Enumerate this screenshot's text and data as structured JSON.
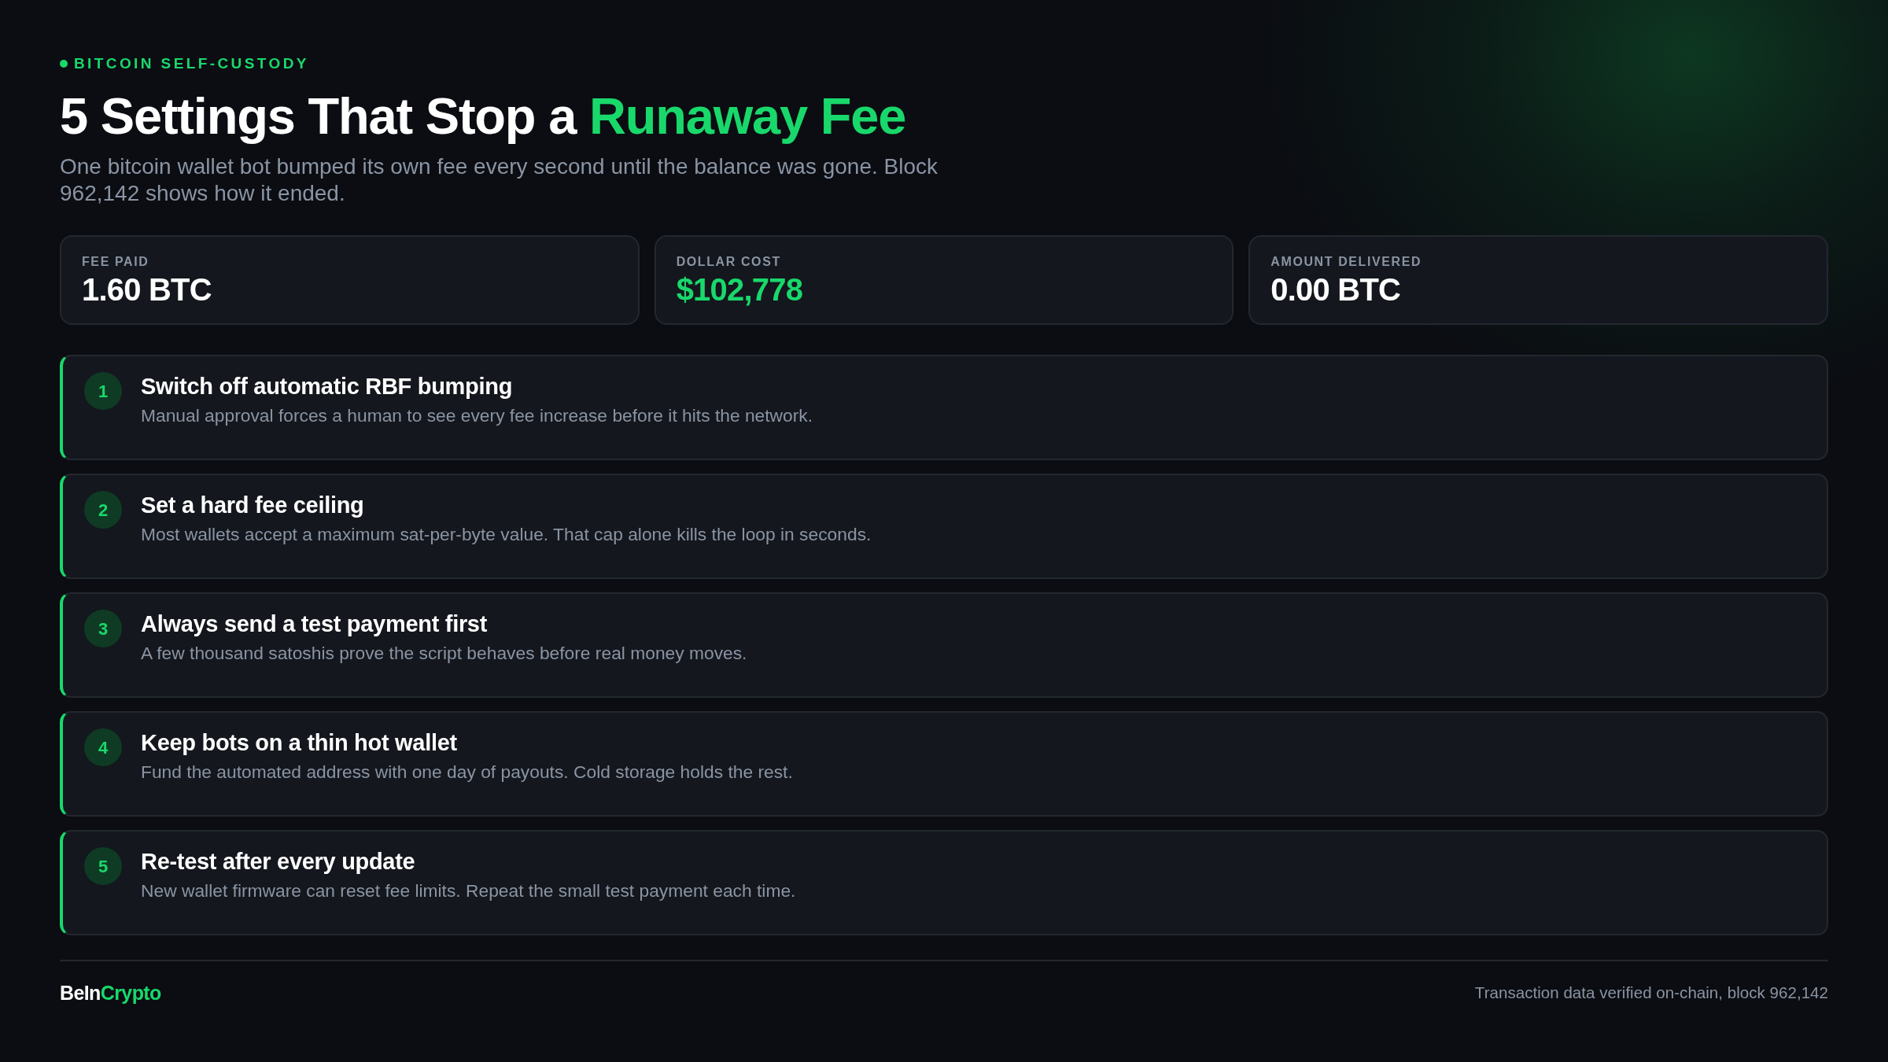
{
  "header": {
    "eyebrow": "BITCOIN SELF-CUSTODY",
    "title_parts": [
      {
        "text": "5 Settings That Stop a",
        "highlight": false
      },
      {
        "text": "Runaway Fee",
        "highlight": true
      }
    ],
    "subtitle": "One bitcoin wallet bot bumped its own fee every second until the balance was gone. Block 962,142 shows how it ended."
  },
  "stats": [
    {
      "label": "FEE PAID",
      "value": "1.60 BTC",
      "highlight": false
    },
    {
      "label": "DOLLAR COST",
      "value": "$102,778",
      "highlight": true
    },
    {
      "label": "AMOUNT DELIVERED",
      "value": "0.00 BTC",
      "highlight": false
    }
  ],
  "steps": [
    {
      "number": "1",
      "title": "Switch off automatic RBF bumping",
      "description": "Manual approval forces a human to see every fee increase before it hits the network."
    },
    {
      "number": "2",
      "title": "Set a hard fee ceiling",
      "description": "Most wallets accept a maximum sat-per-byte value. That cap alone kills the loop in seconds."
    },
    {
      "number": "3",
      "title": "Always send a test payment first",
      "description": "A few thousand satoshis prove the script behaves before real money moves."
    },
    {
      "number": "4",
      "title": "Keep bots on a thin hot wallet",
      "description": "Fund the automated address with one day of payouts. Cold storage holds the rest."
    },
    {
      "number": "5",
      "title": "Re-test after every update",
      "description": "New wallet firmware can reset fee limits. Repeat the small test payment each time."
    }
  ],
  "footer": {
    "logo_parts": [
      {
        "text": "BeIn",
        "highlight": false
      },
      {
        "text": "Crypto",
        "highlight": true
      }
    ],
    "note": "Transaction data verified on-chain, block 962,142"
  }
}
